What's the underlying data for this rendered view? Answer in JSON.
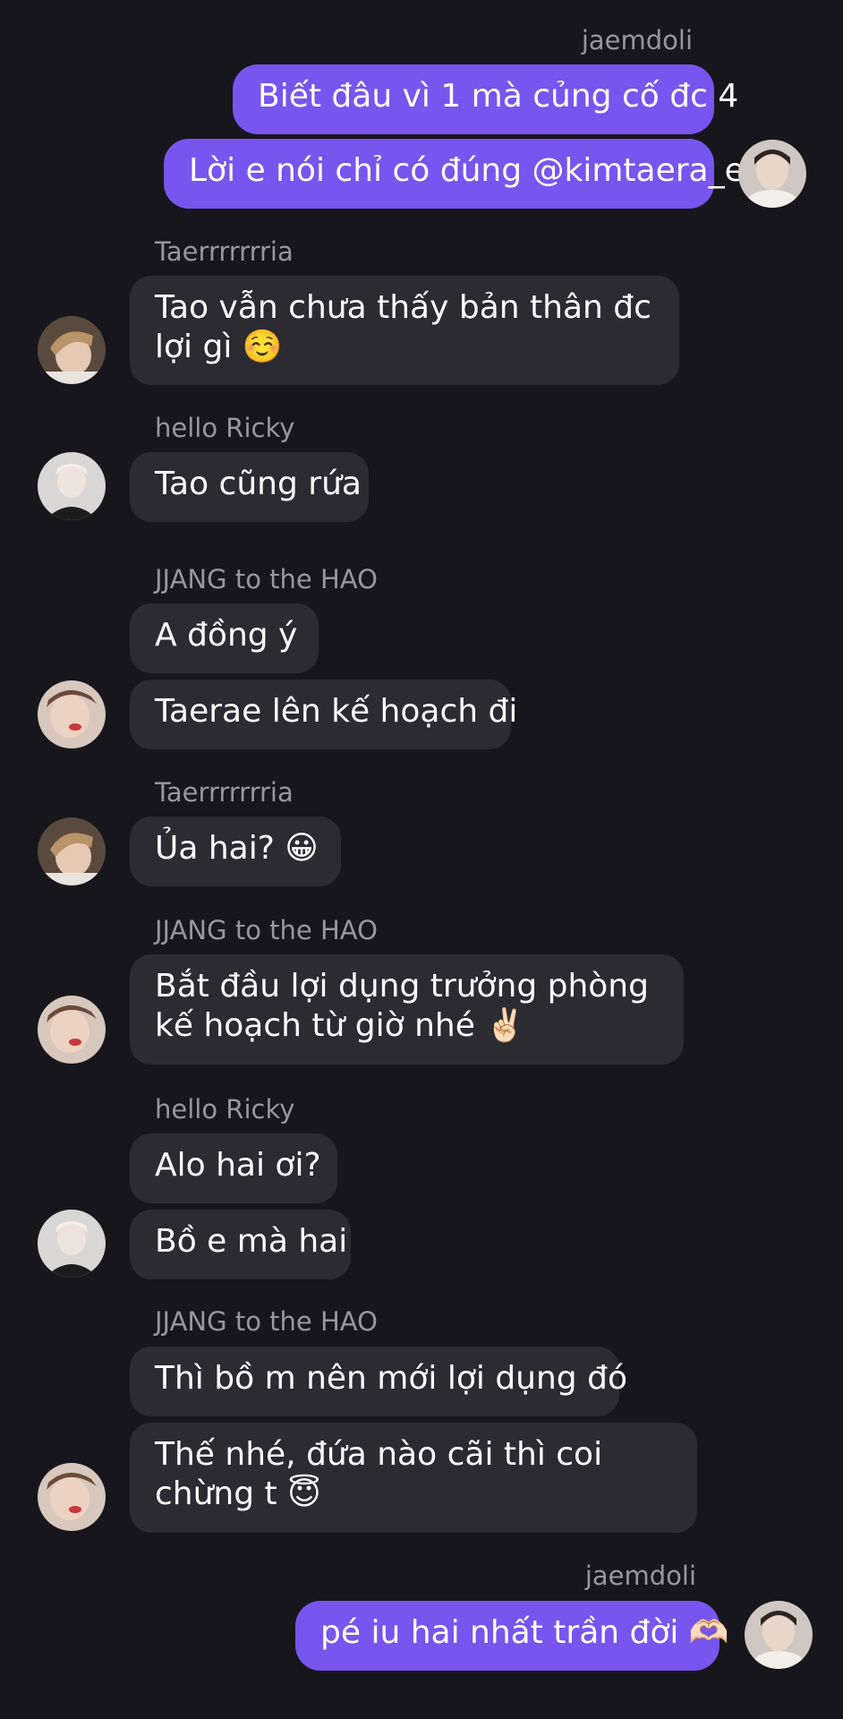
{
  "messages": {
    "n1": "jaemdoli",
    "m1": "Biết đâu vì 1 mà củng cố đc 4",
    "m2": "Lời e nói chỉ có đúng @kimtaera_e",
    "n2": "Taerrrrrrria",
    "m3": "Tao vẫn chưa thấy bản thân đc lợi gì ☺️",
    "n3": "hello Ricky",
    "m4": "Tao cũng rứa",
    "n4": "JJANG to the HAO",
    "m5": "A đồng ý",
    "m6": "Taerae lên kế hoạch đi",
    "n5": "Taerrrrrrria",
    "m7": "Ủa hai? 😀",
    "n6": "JJANG to the HAO",
    "m8": "Bắt đầu lợi dụng trưởng phòng kế hoạch từ giờ nhé ✌🏻",
    "n7": "hello Ricky",
    "m9": "Alo hai ơi?",
    "m10": "Bồ e mà hai",
    "n8": "JJANG to the HAO",
    "m11": "Thì bồ m nên mới lợi dụng đó",
    "m12": "Thế nhé, đứa nào cãi thì coi chừng t 😇",
    "n9": "jaemdoli",
    "m13": "pé iu hai nhất trần đời 🫶🏻"
  },
  "colors": {
    "background": "#17161c",
    "incoming_bubble": "#2b2b31",
    "outgoing_bubble": "#7755ee",
    "sender_name": "#98979e",
    "text": "#ffffff"
  },
  "icons": {
    "avatar_jaemdoli": "avatar-jaemdoli",
    "avatar_taerrrrrrria": "avatar-taerrrrrrria",
    "avatar_hello_ricky": "avatar-hello-ricky",
    "avatar_jjang": "avatar-jjang-to-the-hao"
  }
}
